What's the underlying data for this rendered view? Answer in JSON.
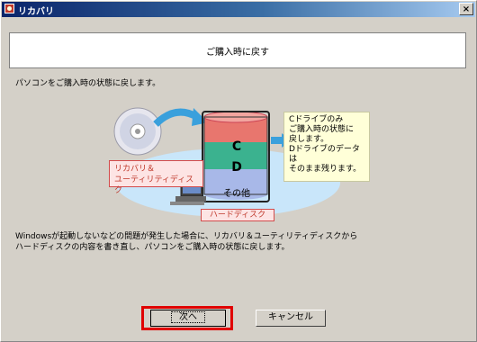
{
  "window": {
    "title": "リカバリ",
    "close_label": "×"
  },
  "header": {
    "text": "ご購入時に戻す"
  },
  "intro": "パソコンをご購入時の状態に戻します。",
  "diagram": {
    "cd_label_line1": "リカバリ＆",
    "cd_label_line2": "ユーティリティディスク",
    "drive_c": "C",
    "drive_d": "D",
    "drive_other": "その他",
    "hd_label": "ハードディスク",
    "note_lines": [
      "Cドライブのみ",
      "ご購入時の状態に",
      "戻します。",
      "Dドライブのデータは",
      "そのまま残ります。"
    ],
    "colors": {
      "c_section": "#e8766e",
      "d_section": "#3bb28f",
      "other_section": "#a8b8e8",
      "ellipse": "#c9e6fa",
      "arrow": "#3aa0dc"
    }
  },
  "description": {
    "line1": "Windowsが起動しないなどの問題が発生した場合に、リカバリ＆ユーティリティディスクから",
    "line2": "ハードディスクの内容を書き直し、パソコンをご購入時の状態に戻します。"
  },
  "buttons": {
    "next": "次へ",
    "cancel": "キャンセル"
  }
}
